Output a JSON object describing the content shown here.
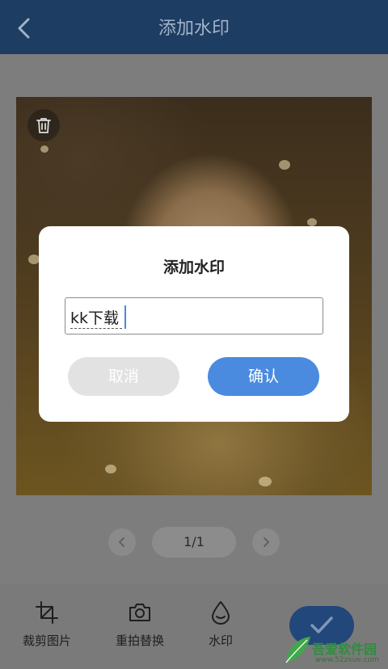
{
  "header": {
    "title": "添加水印",
    "back_icon": "chevron-left-icon"
  },
  "photo": {
    "delete_icon": "trash-icon"
  },
  "pager": {
    "indicator": "1/1",
    "prev_icon": "chevron-left-icon",
    "next_icon": "chevron-right-icon"
  },
  "toolbar": {
    "tools": [
      {
        "label": "裁剪图片",
        "icon": "crop-icon"
      },
      {
        "label": "重拍替换",
        "icon": "camera-icon"
      },
      {
        "label": "水印",
        "icon": "watermark-drop-icon"
      }
    ],
    "confirm_icon": "check-icon"
  },
  "dialog": {
    "title": "添加水印",
    "input_value": "kk下载",
    "cancel_label": "取消",
    "confirm_label": "确认"
  },
  "watermark_brand": {
    "name": "吾爱软件园",
    "url": "www.52zxue.com"
  },
  "colors": {
    "header_bg": "#1e3d63",
    "accent": "#4a8be0",
    "cancel_bg": "#e2e2e2"
  }
}
